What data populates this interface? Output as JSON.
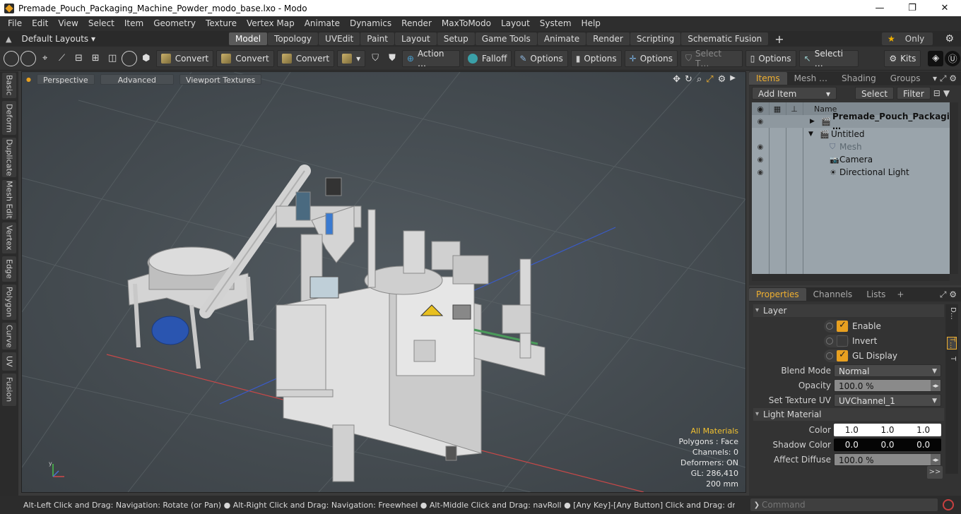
{
  "window": {
    "title": "Premade_Pouch_Packaging_Machine_Powder_modo_base.lxo - Modo",
    "minimize": "—",
    "maximize": "❐",
    "close": "✕"
  },
  "menu": [
    "File",
    "Edit",
    "View",
    "Select",
    "Item",
    "Geometry",
    "Texture",
    "Vertex Map",
    "Animate",
    "Dynamics",
    "Render",
    "MaxToModo",
    "Layout",
    "System",
    "Help"
  ],
  "layouts": {
    "label": "Default Layouts ▾",
    "tabs": [
      "Model",
      "Topology",
      "UVEdit",
      "Paint",
      "Layout",
      "Setup",
      "Game Tools",
      "Animate",
      "Render",
      "Scripting",
      "Schematic Fusion"
    ],
    "active_tab": "Model",
    "only_label": "Only"
  },
  "toolbar": {
    "convert1": "Convert",
    "convert2": "Convert",
    "convert3": "Convert",
    "action": "Action  …",
    "falloff": "Falloff",
    "options1": "Options",
    "options2": "Options",
    "options3": "Options",
    "select_t": "Select T…",
    "options4": "Options",
    "selecti": "Selecti …",
    "kits": "Kits"
  },
  "left_tabs": [
    "Basic",
    "Deform",
    "Duplicate",
    "Mesh Edit",
    "Vertex",
    "Edge",
    "Polygon",
    "Curve",
    "UV",
    "Fusion"
  ],
  "viewport": {
    "perspective": "Perspective",
    "advanced": "Advanced",
    "textures": "Viewport Textures",
    "info": {
      "all_materials": "All Materials",
      "polygons": "Polygons : Face",
      "channels": "Channels: 0",
      "deformers": "Deformers: ON",
      "gl": "GL: 286,410",
      "scale": "200 mm"
    },
    "axis": {
      "x": "x",
      "y": "y",
      "z": "z"
    }
  },
  "items_panel": {
    "tabs": [
      "Items",
      "Mesh …",
      "Shading",
      "Groups"
    ],
    "active": "Items",
    "add_item": "Add Item",
    "select": "Select",
    "filter": "Filter",
    "col_name": "Name",
    "rows": [
      {
        "name": "Premade_Pouch_Packagi …",
        "style": "bold"
      },
      {
        "name": "Untitled",
        "style": "normal"
      },
      {
        "name": "Mesh",
        "style": "dim"
      },
      {
        "name": "Camera",
        "style": "normal"
      },
      {
        "name": "Directional Light",
        "style": "normal"
      }
    ]
  },
  "props_panel": {
    "tabs": [
      "Properties",
      "Channels",
      "Lists"
    ],
    "active": "Properties",
    "layer_section": "Layer",
    "enable": "Enable",
    "invert": "Invert",
    "gl_display": "GL Display",
    "blend_mode_label": "Blend Mode",
    "blend_mode_value": "Normal",
    "opacity_label": "Opacity",
    "opacity_value": "100.0 %",
    "set_texture_uv_label": "Set Texture UV",
    "set_texture_uv_value": "UVChannel_1",
    "light_material_section": "Light Material",
    "color_label": "Color",
    "color_values": [
      "1.0",
      "1.0",
      "1.0"
    ],
    "shadow_color_label": "Shadow Color",
    "shadow_color_values": [
      "0.0",
      "0.0",
      "0.0"
    ],
    "affect_diffuse_label": "Affect Diffuse",
    "affect_diffuse_value": "100.0 %",
    "right_tabs": [
      "D…",
      "T…",
      "T"
    ],
    "more": ">>"
  },
  "status": {
    "hint": "Alt-Left Click and Drag: Navigation: Rotate (or Pan) ● Alt-Right Click and Drag: Navigation: Freewheel ● Alt-Middle Click and Drag: navRoll ● [Any Key]-[Any Button] Click and Drag: dragDropBegin",
    "command_placeholder": "Command"
  },
  "colors": {
    "accent": "#e8a020",
    "viewport_bg": "#4a5156",
    "items_list_bg": "#9aa4ab"
  }
}
